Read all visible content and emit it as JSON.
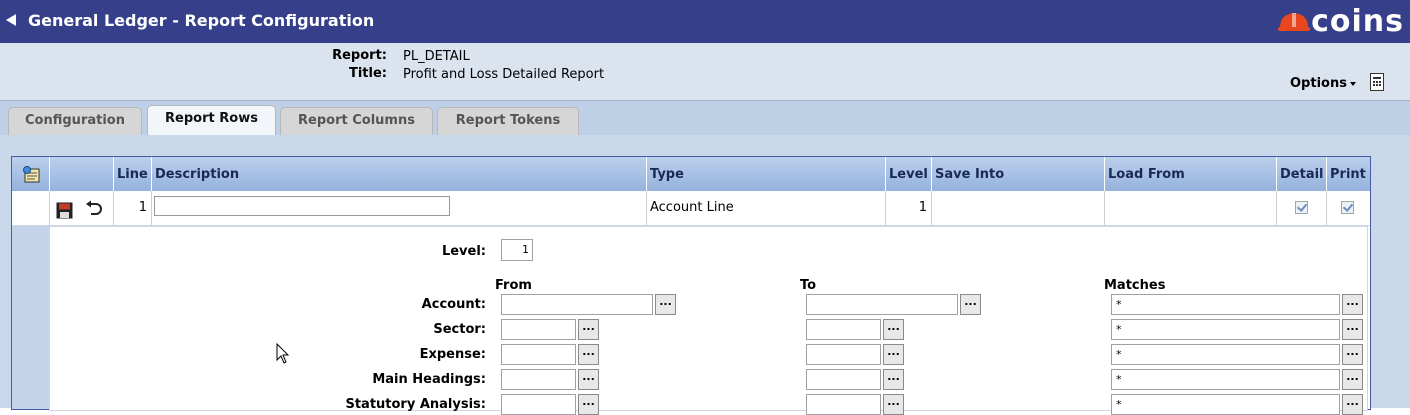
{
  "titlebar": {
    "title": "General Ledger - Report Configuration",
    "logo": "coins",
    "bg_color": "#36408a"
  },
  "header": {
    "report_label": "Report:",
    "report_value": "PL_DETAIL",
    "title_label": "Title:",
    "title_value": "Profit and Loss Detailed Report",
    "options_label": "Options"
  },
  "tabs": [
    {
      "label": "Configuration",
      "active": false
    },
    {
      "label": "Report Rows",
      "active": true
    },
    {
      "label": "Report Columns",
      "active": false
    },
    {
      "label": "Report Tokens",
      "active": false
    }
  ],
  "grid": {
    "columns": [
      "Line",
      "Description",
      "Type",
      "Level",
      "Save Into",
      "Load From",
      "Detail",
      "Print"
    ],
    "row": {
      "line": "1",
      "description": "",
      "type": "Account Line",
      "level": "1",
      "save_into": "",
      "load_from": "",
      "detail": true,
      "print": true
    }
  },
  "detail": {
    "level_label": "Level:",
    "level_value": "1",
    "from_header": "From",
    "to_header": "To",
    "matches_header": "Matches",
    "lookup_label": "...",
    "fields": [
      {
        "label": "Account:",
        "from": "",
        "to": "",
        "matches": "*"
      },
      {
        "label": "Sector:",
        "from": "",
        "to": "",
        "matches": "*"
      },
      {
        "label": "Expense:",
        "from": "",
        "to": "",
        "matches": "*"
      },
      {
        "label": "Main Headings:",
        "from": "",
        "to": "",
        "matches": "*"
      },
      {
        "label": "Statutory Analysis:",
        "from": "",
        "to": "",
        "matches": "*"
      }
    ]
  }
}
